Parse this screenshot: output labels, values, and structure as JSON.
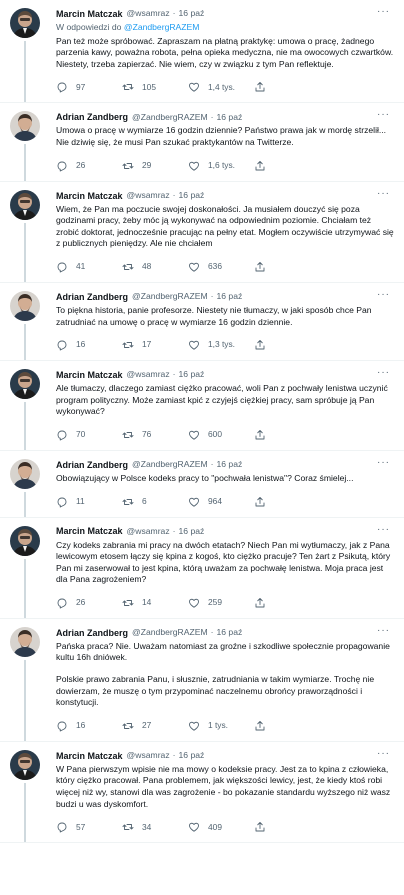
{
  "tweets": [
    {
      "author": "Marcin Matczak",
      "handle": "@wsamraz",
      "time": "16 paź",
      "reply_prefix": "W odpowiedzi do",
      "reply_to": "@ZandbergRAZEM",
      "paragraphs": [
        "Pan też może spróbować. Zapraszam na płatną praktykę: umowa o pracę, żadnego parzenia kawy, poważna robota, pełna opieka medyczna, nie ma owocowych czwartków. Niestety, trzeba zapierzać. Nie wiem, czy w związku z tym Pan reflektuje."
      ],
      "replies": "97",
      "retweets": "105",
      "likes": "1,4 tys.",
      "avatar": "matczak"
    },
    {
      "author": "Adrian Zandberg",
      "handle": "@ZandbergRAZEM",
      "time": "16 paź",
      "paragraphs": [
        "Umowa o pracę w wymiarze 16 godzin dziennie? Państwo prawa jak w mordę strzelił... Nie dziwię się, że musi Pan szukać praktykantów na Twitterze."
      ],
      "replies": "26",
      "retweets": "29",
      "likes": "1,6 tys.",
      "avatar": "zandberg"
    },
    {
      "author": "Marcin Matczak",
      "handle": "@wsamraz",
      "time": "16 paź",
      "paragraphs": [
        "Wiem, że Pan ma poczucie swojej doskonałości. Ja musiałem douczyć się poza godzinami pracy, żeby móc ją wykonywać na odpowiednim poziomie. Chciałam też zrobić doktorat, jednocześnie pracując na pełny etat. Mogłem oczywiście utrzymywać się z publicznych pieniędzy. Ale nie chciałem"
      ],
      "replies": "41",
      "retweets": "48",
      "likes": "636",
      "avatar": "matczak"
    },
    {
      "author": "Adrian Zandberg",
      "handle": "@ZandbergRAZEM",
      "time": "16 paź",
      "paragraphs": [
        "To piękna historia, panie profesorze. Niestety nie tłumaczy, w jaki sposób chce Pan zatrudniać na umowę o pracę w wymiarze 16 godzin dziennie."
      ],
      "replies": "16",
      "retweets": "17",
      "likes": "1,3 tys.",
      "avatar": "zandberg"
    },
    {
      "author": "Marcin Matczak",
      "handle": "@wsamraz",
      "time": "16 paź",
      "paragraphs": [
        "Ale tłumaczy, dlaczego zamiast ciężko pracować, woli Pan z pochwały lenistwa uczynić program polityczny. Może zamiast kpić z czyjejś ciężkiej pracy, sam spróbuje ją Pan wykonywać?"
      ],
      "replies": "70",
      "retweets": "76",
      "likes": "600",
      "avatar": "matczak"
    },
    {
      "author": "Adrian Zandberg",
      "handle": "@ZandbergRAZEM",
      "time": "16 paź",
      "paragraphs": [
        "Obowiązujący w Polsce kodeks pracy to \"pochwała lenistwa\"? Coraz śmielej..."
      ],
      "replies": "11",
      "retweets": "6",
      "likes": "964",
      "avatar": "zandberg"
    },
    {
      "author": "Marcin Matczak",
      "handle": "@wsamraz",
      "time": "16 paź",
      "paragraphs": [
        "Czy kodeks zabrania mi pracy na dwóch etatach? Niech Pan mi wytłumaczy, jak z Pana lewicowym etosem łączy się kpina z kogoś, kto ciężko pracuje? Ten żart z Psikutą, który Pan mi zaserwował to jest kpina, którą uważam za pochwałę lenistwa. Moja praca jest dla Pana zagrożeniem?"
      ],
      "replies": "26",
      "retweets": "14",
      "likes": "259",
      "avatar": "matczak"
    },
    {
      "author": "Adrian Zandberg",
      "handle": "@ZandbergRAZEM",
      "time": "16 paź",
      "paragraphs": [
        "Pańska praca? Nie. Uważam natomiast za groźne i szkodliwe społecznie propagowanie kultu 16h dniówek.",
        "Polskie prawo zabrania Panu, i słusznie, zatrudniania w takim wymiarze. Trochę nie dowierzam, że muszę o tym przypominać naczelnemu obrońcy praworządności i konstytucji."
      ],
      "replies": "16",
      "retweets": "27",
      "likes": "1 tys.",
      "avatar": "zandberg"
    },
    {
      "author": "Marcin Matczak",
      "handle": "@wsamraz",
      "time": "16 paź",
      "paragraphs": [
        "W Pana pierwszym wpisie nie ma mowy o kodeksie pracy. Jest za to kpina z człowieka, który ciężko pracował. Pana problemem, jak większości lewicy, jest, że kiedy ktoś robi więcej niż wy, stanowi dla was zagrożenie - bo pokazanie standardu wyższego niż wasz budzi u was dyskomfort."
      ],
      "replies": "57",
      "retweets": "34",
      "likes": "409",
      "avatar": "matczak"
    }
  ],
  "colors": {
    "text": "#0f1419",
    "muted": "#536471",
    "link": "#1d9bf0",
    "divider": "#eff3f4"
  },
  "icons": [
    "reply-icon",
    "retweet-icon",
    "like-icon",
    "share-icon",
    "more-icon"
  ]
}
